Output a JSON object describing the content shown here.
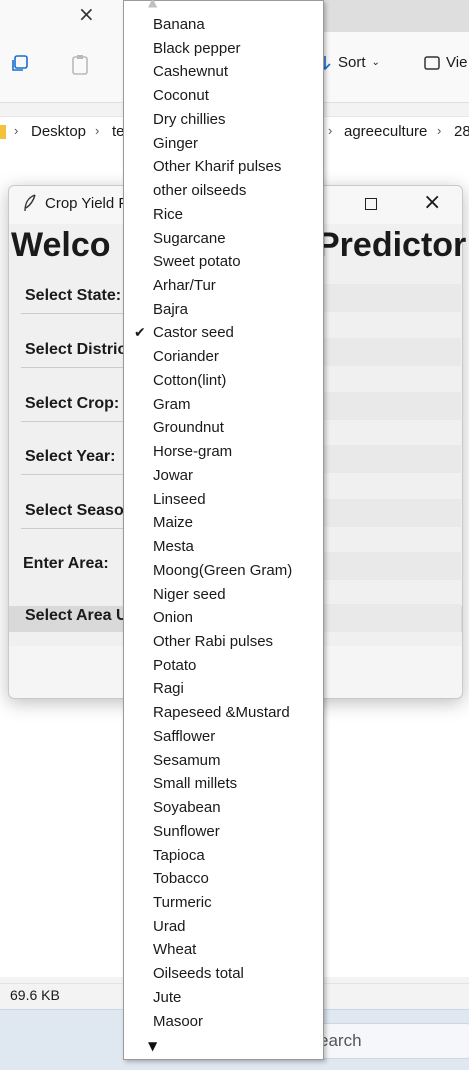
{
  "explorer": {
    "tab_close": "×",
    "sort_label": "Sort",
    "view_label": "Vie",
    "breadcrumbs": [
      "Desktop",
      "te",
      "agreeculture",
      "28"
    ],
    "status_size": "69.6 KB",
    "taskbar_search": "earch"
  },
  "app": {
    "title": "Crop Yield P",
    "welcome_left": "Welco",
    "welcome_right": "Predictor",
    "labels": {
      "state": "Select State:",
      "district": "Select Distric",
      "crop": "Select Crop:",
      "year": "Select Year:",
      "season": "Select Seaso",
      "area": "Enter Area:",
      "area_unit": "Select Area U"
    }
  },
  "dropdown": {
    "selected": "Castor seed",
    "items": [
      "Banana",
      "Black pepper",
      "Cashewnut",
      "Coconut",
      "Dry chillies",
      "Ginger",
      "Other Kharif pulses",
      "other oilseeds",
      "Rice",
      "Sugarcane",
      "Sweet potato",
      "Arhar/Tur",
      "Bajra",
      "Castor seed",
      "Coriander",
      "Cotton(lint)",
      "Gram",
      "Groundnut",
      "Horse-gram",
      "Jowar",
      "Linseed",
      "Maize",
      "Mesta",
      "Moong(Green Gram)",
      "Niger seed",
      "Onion",
      "Other Rabi pulses",
      "Potato",
      "Ragi",
      "Rapeseed &Mustard",
      "Safflower",
      "Sesamum",
      "Small millets",
      "Soyabean",
      "Sunflower",
      "Tapioca",
      "Tobacco",
      "Turmeric",
      "Urad",
      "Wheat",
      "Oilseeds total",
      "Jute",
      "Masoor"
    ]
  }
}
